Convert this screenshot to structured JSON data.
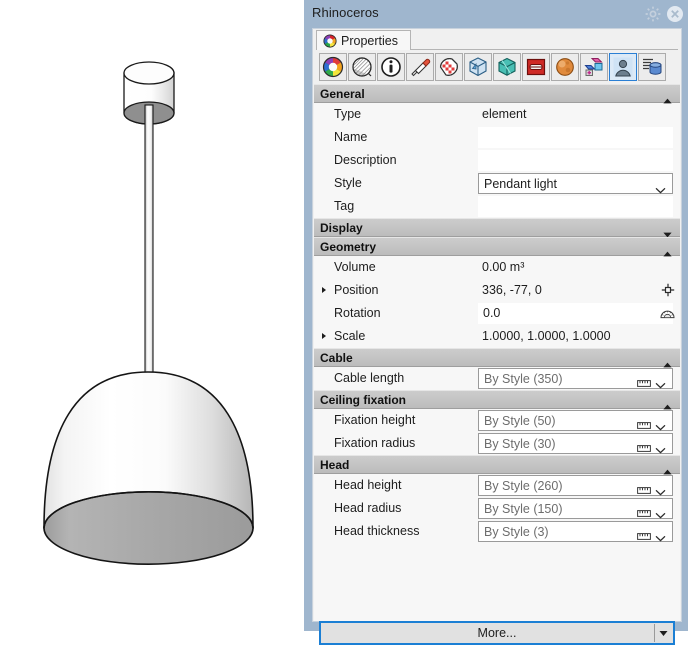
{
  "window": {
    "title": "Rhinoceros",
    "gear_icon": "gear-icon",
    "close_icon": "close-circle-icon"
  },
  "tab": {
    "label": "Properties",
    "icon": "color-wheel-icon"
  },
  "toolbar": {
    "icons": [
      {
        "name": "color-wheel-icon",
        "title": "Object"
      },
      {
        "name": "sphere-shaded-icon",
        "title": "Display"
      },
      {
        "name": "info-circle-icon",
        "title": "Details"
      },
      {
        "name": "paint-brush-icon",
        "title": "Material"
      },
      {
        "name": "texture-map-icon",
        "title": "Texture Mapping"
      },
      {
        "name": "cube-light-icon",
        "title": "Light"
      },
      {
        "name": "cube-teal-icon",
        "title": "Mesh"
      },
      {
        "name": "red-box-icon",
        "title": "Print"
      },
      {
        "name": "orange-sphere-icon",
        "title": "Render"
      },
      {
        "name": "link-blocks-icon",
        "title": "Block"
      },
      {
        "name": "person-avatar-icon",
        "title": "User Text"
      },
      {
        "name": "database-list-icon",
        "title": "Data"
      }
    ],
    "active_index": 10
  },
  "sections": [
    {
      "name": "General",
      "expanded": true,
      "rows": [
        {
          "label": "Type",
          "value": "element",
          "field": "text",
          "expander": false
        },
        {
          "label": "Name",
          "value": "",
          "field": "blank",
          "expander": false
        },
        {
          "label": "Description",
          "value": "",
          "field": "blank",
          "expander": false
        },
        {
          "label": "Style",
          "value": "Pendant light",
          "field": "combo",
          "expander": false
        },
        {
          "label": "Tag",
          "value": "",
          "field": "blank",
          "expander": false
        }
      ]
    },
    {
      "name": "Display",
      "expanded": false,
      "rows": []
    },
    {
      "name": "Geometry",
      "expanded": true,
      "rows": [
        {
          "label": "Volume",
          "value": "0.00 m³",
          "field": "text",
          "expander": false
        },
        {
          "label": "Position",
          "value": "336, -77, 0",
          "field": "text",
          "expander": true,
          "icon": "position-target-icon"
        },
        {
          "label": "Rotation",
          "value": "0.0",
          "field": "input",
          "expander": false,
          "icon": "protractor-icon"
        },
        {
          "label": "Scale",
          "value": "1.0000, 1.0000, 1.0000",
          "field": "text",
          "expander": true
        }
      ]
    },
    {
      "name": "Cable",
      "expanded": true,
      "rows": [
        {
          "label": "Cable length",
          "value": "By Style (350)",
          "field": "styled",
          "expander": false
        }
      ]
    },
    {
      "name": "Ceiling fixation",
      "expanded": true,
      "rows": [
        {
          "label": "Fixation height",
          "value": "By Style (50)",
          "field": "styled",
          "expander": false
        },
        {
          "label": "Fixation radius",
          "value": "By Style (30)",
          "field": "styled",
          "expander": false
        }
      ]
    },
    {
      "name": "Head",
      "expanded": true,
      "rows": [
        {
          "label": "Head height",
          "value": "By Style (260)",
          "field": "styled",
          "expander": false
        },
        {
          "label": "Head radius",
          "value": "By Style (150)",
          "field": "styled",
          "expander": false
        },
        {
          "label": "Head thickness",
          "value": "By Style (3)",
          "field": "styled",
          "expander": false
        }
      ]
    }
  ],
  "more_button": {
    "label": "More...",
    "dropdown_icon": "caret-down-icon"
  },
  "colors": {
    "panel_chrome": "#9fb6ce",
    "section_header": "#c4c4c4",
    "list_bg": "#f7f7f7",
    "accent_focus": "#1b7fd4",
    "text": "#1d1d1d",
    "muted_text": "#6d6d6d"
  },
  "viewport": {
    "object": "pendant-lamp-3d-model"
  }
}
